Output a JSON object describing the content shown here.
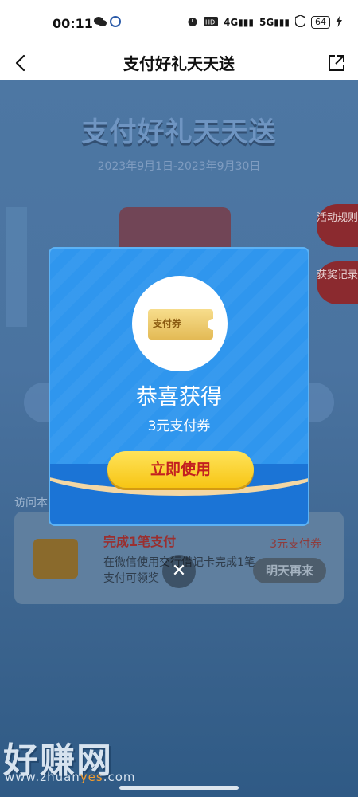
{
  "status_bar": {
    "time": "00:11",
    "left_icons": [
      "wechat-icon",
      "app-icon"
    ],
    "right_icons": [
      "alarm-icon",
      "hd-icon",
      "signal-4g-icon",
      "signal-5g-icon",
      "shield-icon"
    ],
    "sig1": "4G",
    "sig2": "5G",
    "battery": "64"
  },
  "nav": {
    "title": "支付好礼天天送"
  },
  "background": {
    "banner_title": "支付好礼天天送",
    "date_range": "2023年9月1日-2023年9月30日",
    "side_rules": "活动规则",
    "side_records": "获奖记录",
    "visit_text": "访问本",
    "task": {
      "title": "完成1笔支付",
      "desc": "在微信使用交行借记卡完成1笔支付可领奖",
      "reward": "3元支付券",
      "button": "明天再来"
    }
  },
  "modal": {
    "coupon_label": "支付券",
    "heading": "恭喜获得",
    "subtext": "3元支付券",
    "use_button": "立即使用",
    "close": "✕"
  },
  "watermark": {
    "main": "好赚网",
    "url_prefix": "www.zhuan",
    "url_yes": "yes",
    "url_suffix": ".com"
  },
  "colors": {
    "modal_blue": "#2f96ee",
    "button_yellow": "#f7c514",
    "button_text_red": "#c32020"
  }
}
